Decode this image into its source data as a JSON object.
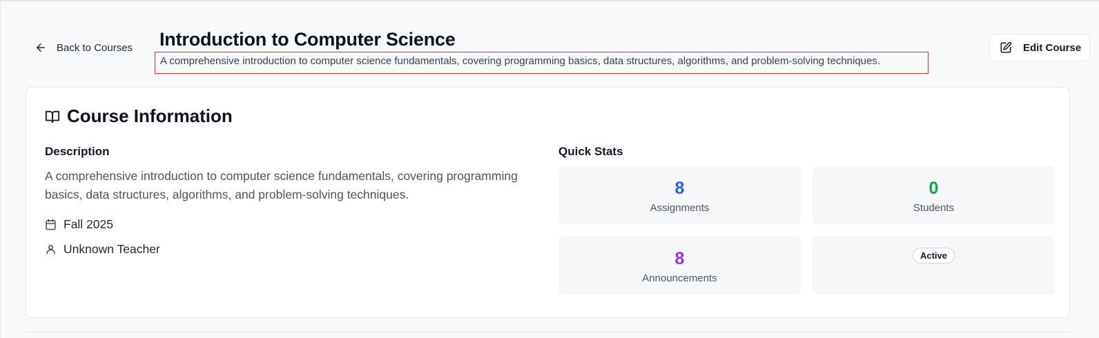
{
  "header": {
    "back_label": "Back to Courses",
    "title": "Introduction to Computer Science",
    "subtitle": "A comprehensive introduction to computer science fundamentals, covering programming basics, data structures, algorithms, and problem-solving techniques.",
    "edit_label": "Edit Course"
  },
  "course_info": {
    "heading": "Course Information",
    "description_label": "Description",
    "description": "A comprehensive introduction to computer science fundamentals, covering programming basics, data structures, algorithms, and problem-solving techniques.",
    "term": "Fall 2025",
    "teacher": "Unknown Teacher"
  },
  "quick_stats": {
    "heading": "Quick Stats",
    "assignments": {
      "value": "8",
      "label": "Assignments",
      "color": "#2563eb"
    },
    "students": {
      "value": "0",
      "label": "Students",
      "color": "#16a34a"
    },
    "announcements": {
      "value": "8",
      "label": "Announcements",
      "color": "#9333ea"
    },
    "status": "Active"
  },
  "icons": {
    "back": "arrow-left-icon",
    "edit": "pencil-square-icon",
    "course": "book-open-icon",
    "term": "calendar-icon",
    "teacher": "user-icon"
  }
}
